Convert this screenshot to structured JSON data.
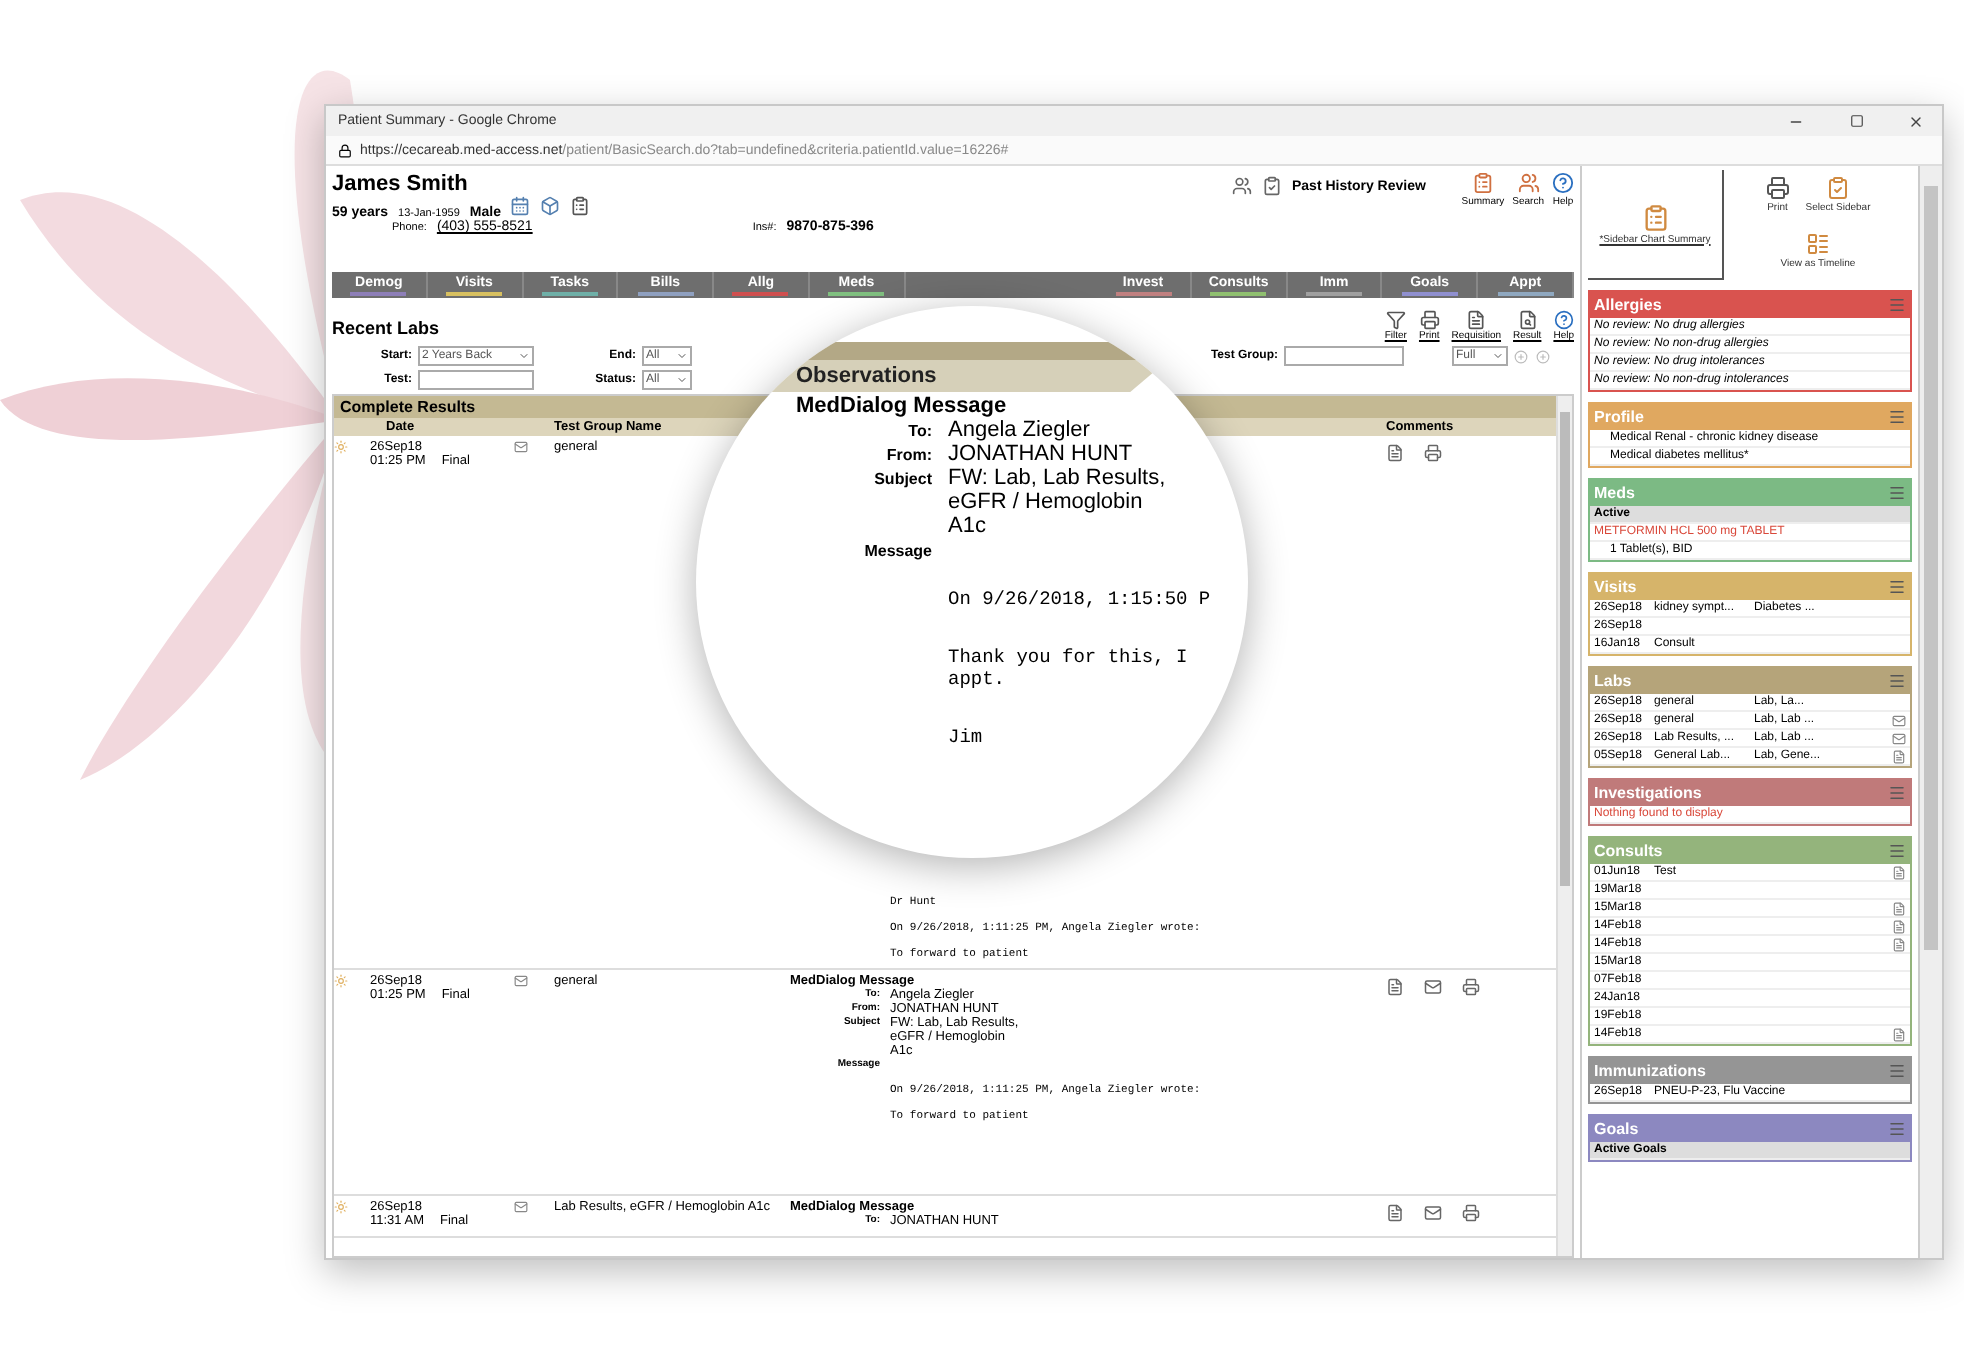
{
  "window": {
    "title": "Patient Summary - Google Chrome",
    "url_host": "https://cecareab.med-access.net",
    "url_path": "/patient/BasicSearch.do?tab=undefined&criteria.patientId.value=16226#"
  },
  "patient": {
    "name": "James Smith",
    "age": "59 years",
    "dob": "13-Jan-1959",
    "sex": "Male",
    "phone_label": "Phone:",
    "phone": "(403) 555-8521",
    "ins_label": "Ins#:",
    "ins": "9870-875-396"
  },
  "header_center": "Past History Review",
  "header_actions": [
    {
      "kind": "summary",
      "label": "Summary"
    },
    {
      "kind": "search",
      "label": "Search"
    },
    {
      "kind": "help",
      "label": "Help"
    }
  ],
  "tabs_left": [
    {
      "label": "Demog",
      "color": "#8e7fb8"
    },
    {
      "label": "Visits",
      "color": "#d8c060"
    },
    {
      "label": "Tasks",
      "color": "#6fb0a8"
    },
    {
      "label": "Bills",
      "color": "#8fa0c0"
    },
    {
      "label": "Allg",
      "color": "#d05050"
    },
    {
      "label": "Meds",
      "color": "#80c080"
    }
  ],
  "tabs_right": [
    {
      "label": "Invest",
      "color": "#c08080"
    },
    {
      "label": "Consults",
      "color": "#90c070"
    },
    {
      "label": "Imm",
      "color": "#a0a0a0"
    },
    {
      "label": "Goals",
      "color": "#9090d0"
    },
    {
      "label": "Appt",
      "color": "#8fa8c0"
    }
  ],
  "section_title": "Recent Labs",
  "toolbar": [
    {
      "kind": "filter",
      "label": "Filter"
    },
    {
      "kind": "print",
      "label": "Print"
    },
    {
      "kind": "requisition",
      "label": "Requisition"
    },
    {
      "kind": "result",
      "label": "Result"
    },
    {
      "kind": "help",
      "label": "Help"
    }
  ],
  "filters": {
    "start_label": "Start:",
    "start": "2 Years Back",
    "end_label": "End:",
    "end": "All",
    "test_group_label": "Test Group:",
    "view": "Full",
    "test_label": "Test:",
    "status_label": "Status:",
    "status": "All"
  },
  "results": {
    "title": "Complete Results",
    "columns": [
      "Date",
      "Test Group Name",
      "Comments"
    ],
    "rows": [
      {
        "date": "26Sep18",
        "time": "01:25 PM",
        "status": "Final",
        "group": "general",
        "body": [
          "Dr Hunt",
          "On 9/26/2018, 1:11:25 PM, Angela Ziegler wrote:",
          "To forward to patient"
        ],
        "mail_action": false
      },
      {
        "date": "26Sep18",
        "time": "01:25 PM",
        "status": "Final",
        "group": "general",
        "message": {
          "title": "MedDialog Message",
          "fields": [
            {
              "label": "To:",
              "value": "Angela Ziegler"
            },
            {
              "label": "From:",
              "value": "JONATHAN HUNT"
            },
            {
              "label": "Subject",
              "value": "FW: Lab, Lab Results,"
            },
            {
              "value": "eGFR / Hemoglobin"
            },
            {
              "value": "A1c"
            },
            {
              "label": "Message"
            }
          ]
        },
        "body": [
          "On 9/26/2018, 1:11:25 PM, Angela Ziegler wrote:",
          "To forward to patient"
        ],
        "mail_action": true
      },
      {
        "date": "26Sep18",
        "time": "11:31 AM",
        "status": "Final",
        "group": "Lab Results, eGFR / Hemoglobin A1c",
        "message": {
          "title": "MedDialog Message",
          "fields": [
            {
              "label": "To:",
              "value": "JONATHAN HUNT"
            }
          ]
        },
        "body": [],
        "mail_action": true
      }
    ]
  },
  "magnifier": {
    "header": "Observations",
    "title": "MedDialog Message",
    "fields": [
      {
        "label": "To:",
        "value": "Angela Ziegler"
      },
      {
        "label": "From:",
        "value": "JONATHAN HUNT"
      },
      {
        "label": "Subject",
        "value": "FW: Lab, Lab Results,"
      },
      {
        "value": "eGFR / Hemoglobin"
      },
      {
        "value": "A1c"
      },
      {
        "label": "Message"
      }
    ],
    "body": [
      "On 9/26/2018, 1:15:50 P",
      "Thank you for this, I",
      "appt.",
      "Jim"
    ]
  },
  "sidebar": {
    "tools": [
      {
        "kind": "summary",
        "label": "*Sidebar Chart Summary"
      },
      {
        "kind": "print",
        "label": "Print"
      },
      {
        "kind": "select",
        "label": "Select Sidebar"
      },
      {
        "kind": "timeline",
        "label": "View as Timeline"
      }
    ],
    "panels": [
      {
        "title": "Allergies",
        "color": "#d9534f",
        "rows": [
          {
            "kind": "italic",
            "cells": [
              "No review: No drug allergies"
            ]
          },
          {
            "kind": "italic",
            "cells": [
              "No review: No non-drug allergies"
            ]
          },
          {
            "kind": "italic",
            "cells": [
              "No review: No drug intolerances"
            ]
          },
          {
            "kind": "italic",
            "cells": [
              "No review: No non-drug intolerances"
            ]
          }
        ]
      },
      {
        "title": "Profile",
        "color": "#e0a860",
        "rows": [
          {
            "kind": "indent",
            "cells": [
              "Medical Renal - chronic kidney disease"
            ]
          },
          {
            "kind": "indent",
            "cells": [
              "Medical diabetes mellitus*"
            ]
          }
        ]
      },
      {
        "title": "Meds",
        "color": "#7cba84",
        "rows": [
          {
            "kind": "subhead",
            "cells": [
              "Active"
            ]
          },
          {
            "kind": "alert",
            "cells": [
              "METFORMIN HCL 500 mg TABLET"
            ]
          },
          {
            "kind": "indent",
            "cells": [
              "1 Tablet(s), BID"
            ]
          }
        ]
      },
      {
        "title": "Visits",
        "color": "#d6b46a",
        "rows": [
          {
            "kind": "plain",
            "cells": [
              "26Sep18",
              "kidney sympt...",
              "Diabetes ..."
            ]
          },
          {
            "kind": "plain",
            "cells": [
              "26Sep18"
            ]
          },
          {
            "kind": "plain",
            "cells": [
              "16Jan18",
              "Consult"
            ]
          }
        ]
      },
      {
        "title": "Labs",
        "color": "#b5a47a",
        "rows": [
          {
            "kind": "plain",
            "cells": [
              "26Sep18",
              "general",
              "Lab, La..."
            ]
          },
          {
            "kind": "plain",
            "cells": [
              "26Sep18",
              "general",
              "Lab, Lab ..."
            ],
            "message": true
          },
          {
            "kind": "plain",
            "cells": [
              "26Sep18",
              "Lab Results, ...",
              "Lab, Lab ..."
            ],
            "message": true
          },
          {
            "kind": "plain",
            "cells": [
              "05Sep18",
              "General Lab...",
              "Lab, Gene..."
            ],
            "document": true
          }
        ]
      },
      {
        "title": "Investigations",
        "color": "#c07a7a",
        "rows": [
          {
            "kind": "alert",
            "cells": [
              "Nothing found to display"
            ]
          }
        ]
      },
      {
        "title": "Consults",
        "color": "#94b47c",
        "rows": [
          {
            "kind": "plain",
            "cells": [
              "01Jun18",
              "Test"
            ],
            "document": true
          },
          {
            "kind": "plain",
            "cells": [
              "19Mar18"
            ]
          },
          {
            "kind": "plain",
            "cells": [
              "15Mar18"
            ],
            "document": true
          },
          {
            "kind": "plain",
            "cells": [
              "14Feb18"
            ],
            "document": true
          },
          {
            "kind": "plain",
            "cells": [
              "14Feb18"
            ],
            "document": true
          },
          {
            "kind": "plain",
            "cells": [
              "15Mar18"
            ]
          },
          {
            "kind": "plain",
            "cells": [
              "07Feb18"
            ]
          },
          {
            "kind": "plain",
            "cells": [
              "24Jan18"
            ]
          },
          {
            "kind": "plain",
            "cells": [
              "19Feb18"
            ]
          },
          {
            "kind": "plain",
            "cells": [
              "14Feb18"
            ],
            "document": true
          }
        ]
      },
      {
        "title": "Immunizations",
        "color": "#959595",
        "rows": [
          {
            "kind": "plain",
            "cells": [
              "26Sep18",
              "PNEU-P-23, Flu Vaccine"
            ]
          }
        ]
      },
      {
        "title": "Goals",
        "color": "#8c88c0",
        "rows": [
          {
            "kind": "subhead",
            "cells": [
              "Active Goals"
            ]
          }
        ]
      }
    ]
  }
}
